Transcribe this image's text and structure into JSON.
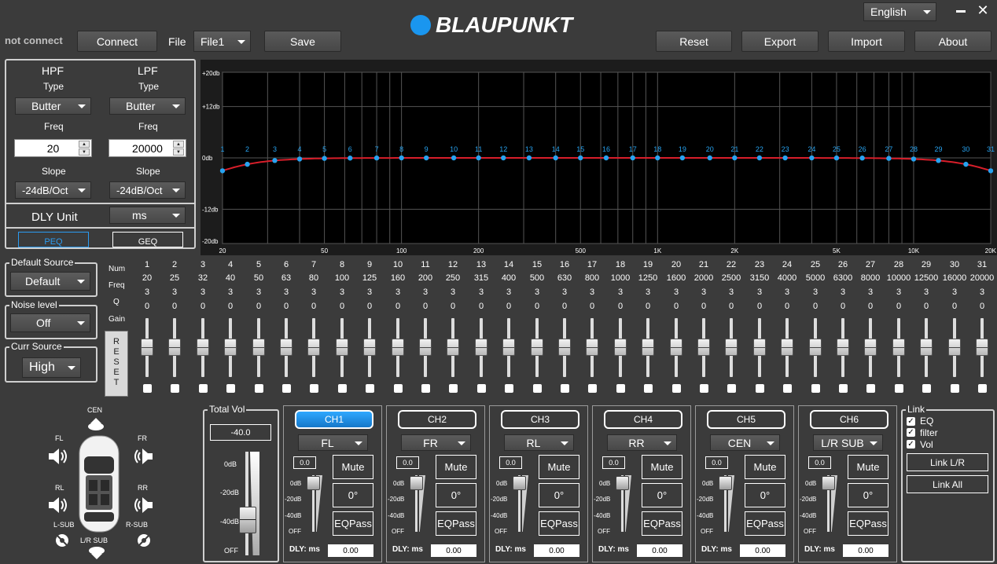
{
  "app": {
    "logo_text": "BLAUPUNKT",
    "language": "English",
    "minimize_icon": "minimize-icon",
    "close_icon": "close-icon"
  },
  "toolbar": {
    "status": "not connect",
    "connect": "Connect",
    "file_label": "File",
    "file_value": "File1",
    "save": "Save",
    "reset": "Reset",
    "export": "Export",
    "import": "Import",
    "about": "About"
  },
  "filters": {
    "hpf": {
      "title": "HPF",
      "type_label": "Type",
      "type": "Butter",
      "freq_label": "Freq",
      "freq": "20",
      "slope_label": "Slope",
      "slope": "-24dB/Oct"
    },
    "lpf": {
      "title": "LPF",
      "type_label": "Type",
      "type": "Butter",
      "freq_label": "Freq",
      "freq": "20000",
      "slope_label": "Slope",
      "slope": "-24dB/Oct"
    },
    "dly_unit_label": "DLY Unit",
    "dly_unit": "ms",
    "peq": "PEQ",
    "geq": "GEQ"
  },
  "graph": {
    "y_labels": [
      "+20db",
      "+12db",
      "0db",
      "-12db",
      "-20db"
    ],
    "x_labels": [
      "20",
      "50",
      "100",
      "200",
      "500",
      "1K",
      "2K",
      "5K",
      "10K",
      "20K"
    ],
    "curve_color": "#d81e2a",
    "point_color": "#27a3f0"
  },
  "sources": {
    "default_source_title": "Default Source",
    "default_source": "Default",
    "noise_level_title": "Noise level",
    "noise_level": "Off",
    "curr_source_title": "Curr Source",
    "curr_source": "High"
  },
  "eq": {
    "row_labels": {
      "num": "Num",
      "freq": "Freq",
      "q": "Q",
      "gain": "Gain"
    },
    "reset": "RESET",
    "bands": [
      {
        "num": "1",
        "freq": "20",
        "q": "3",
        "gain": "0"
      },
      {
        "num": "2",
        "freq": "25",
        "q": "3",
        "gain": "0"
      },
      {
        "num": "3",
        "freq": "32",
        "q": "3",
        "gain": "0"
      },
      {
        "num": "4",
        "freq": "40",
        "q": "3",
        "gain": "0"
      },
      {
        "num": "5",
        "freq": "50",
        "q": "3",
        "gain": "0"
      },
      {
        "num": "6",
        "freq": "63",
        "q": "3",
        "gain": "0"
      },
      {
        "num": "7",
        "freq": "80",
        "q": "3",
        "gain": "0"
      },
      {
        "num": "8",
        "freq": "100",
        "q": "3",
        "gain": "0"
      },
      {
        "num": "9",
        "freq": "125",
        "q": "3",
        "gain": "0"
      },
      {
        "num": "10",
        "freq": "160",
        "q": "3",
        "gain": "0"
      },
      {
        "num": "11",
        "freq": "200",
        "q": "3",
        "gain": "0"
      },
      {
        "num": "12",
        "freq": "250",
        "q": "3",
        "gain": "0"
      },
      {
        "num": "13",
        "freq": "315",
        "q": "3",
        "gain": "0"
      },
      {
        "num": "14",
        "freq": "400",
        "q": "3",
        "gain": "0"
      },
      {
        "num": "15",
        "freq": "500",
        "q": "3",
        "gain": "0"
      },
      {
        "num": "16",
        "freq": "630",
        "q": "3",
        "gain": "0"
      },
      {
        "num": "17",
        "freq": "800",
        "q": "3",
        "gain": "0"
      },
      {
        "num": "18",
        "freq": "1000",
        "q": "3",
        "gain": "0"
      },
      {
        "num": "19",
        "freq": "1250",
        "q": "3",
        "gain": "0"
      },
      {
        "num": "20",
        "freq": "1600",
        "q": "3",
        "gain": "0"
      },
      {
        "num": "21",
        "freq": "2000",
        "q": "3",
        "gain": "0"
      },
      {
        "num": "22",
        "freq": "2500",
        "q": "3",
        "gain": "0"
      },
      {
        "num": "23",
        "freq": "3150",
        "q": "3",
        "gain": "0"
      },
      {
        "num": "24",
        "freq": "4000",
        "q": "3",
        "gain": "0"
      },
      {
        "num": "25",
        "freq": "5000",
        "q": "3",
        "gain": "0"
      },
      {
        "num": "26",
        "freq": "6300",
        "q": "3",
        "gain": "0"
      },
      {
        "num": "27",
        "freq": "8000",
        "q": "3",
        "gain": "0"
      },
      {
        "num": "28",
        "freq": "10000",
        "q": "3",
        "gain": "0"
      },
      {
        "num": "29",
        "freq": "12500",
        "q": "3",
        "gain": "0"
      },
      {
        "num": "30",
        "freq": "16000",
        "q": "3",
        "gain": "0"
      },
      {
        "num": "31",
        "freq": "20000",
        "q": "3",
        "gain": "0"
      }
    ]
  },
  "car": {
    "cen": "CEN",
    "fl": "FL",
    "fr": "FR",
    "rl": "RL",
    "rr": "RR",
    "lsub": "L-SUB",
    "rsub": "R-SUB",
    "lrsub": "L/R SUB"
  },
  "total_vol": {
    "title": "Total Vol",
    "value": "-40.0",
    "scale": [
      "0dB",
      "-20dB",
      "-40dB",
      "OFF"
    ]
  },
  "channels": [
    {
      "name": "CH1",
      "output": "FL",
      "gain": "0.0",
      "mute": "Mute",
      "phase": "0°",
      "eqpass": "EQPass",
      "dly_label": "DLY: ms",
      "dly": "0.00",
      "active": true
    },
    {
      "name": "CH2",
      "output": "FR",
      "gain": "0.0",
      "mute": "Mute",
      "phase": "0°",
      "eqpass": "EQPass",
      "dly_label": "DLY: ms",
      "dly": "0.00",
      "active": false
    },
    {
      "name": "CH3",
      "output": "RL",
      "gain": "0.0",
      "mute": "Mute",
      "phase": "0°",
      "eqpass": "EQPass",
      "dly_label": "DLY: ms",
      "dly": "0.00",
      "active": false
    },
    {
      "name": "CH4",
      "output": "RR",
      "gain": "0.0",
      "mute": "Mute",
      "phase": "0°",
      "eqpass": "EQPass",
      "dly_label": "DLY: ms",
      "dly": "0.00",
      "active": false
    },
    {
      "name": "CH5",
      "output": "CEN",
      "gain": "0.0",
      "mute": "Mute",
      "phase": "0°",
      "eqpass": "EQPass",
      "dly_label": "DLY: ms",
      "dly": "0.00",
      "active": false
    },
    {
      "name": "CH6",
      "output": "L/R SUB",
      "gain": "0.0",
      "mute": "Mute",
      "phase": "0°",
      "eqpass": "EQPass",
      "dly_label": "DLY: ms",
      "dly": "0.00",
      "active": false
    }
  ],
  "ch_scale": [
    "0dB",
    "-20dB",
    "-40dB",
    "OFF"
  ],
  "link": {
    "title": "Link",
    "eq": "EQ",
    "filter": "filter",
    "vol": "Vol",
    "link_lr": "Link L/R",
    "link_all": "Link All"
  }
}
